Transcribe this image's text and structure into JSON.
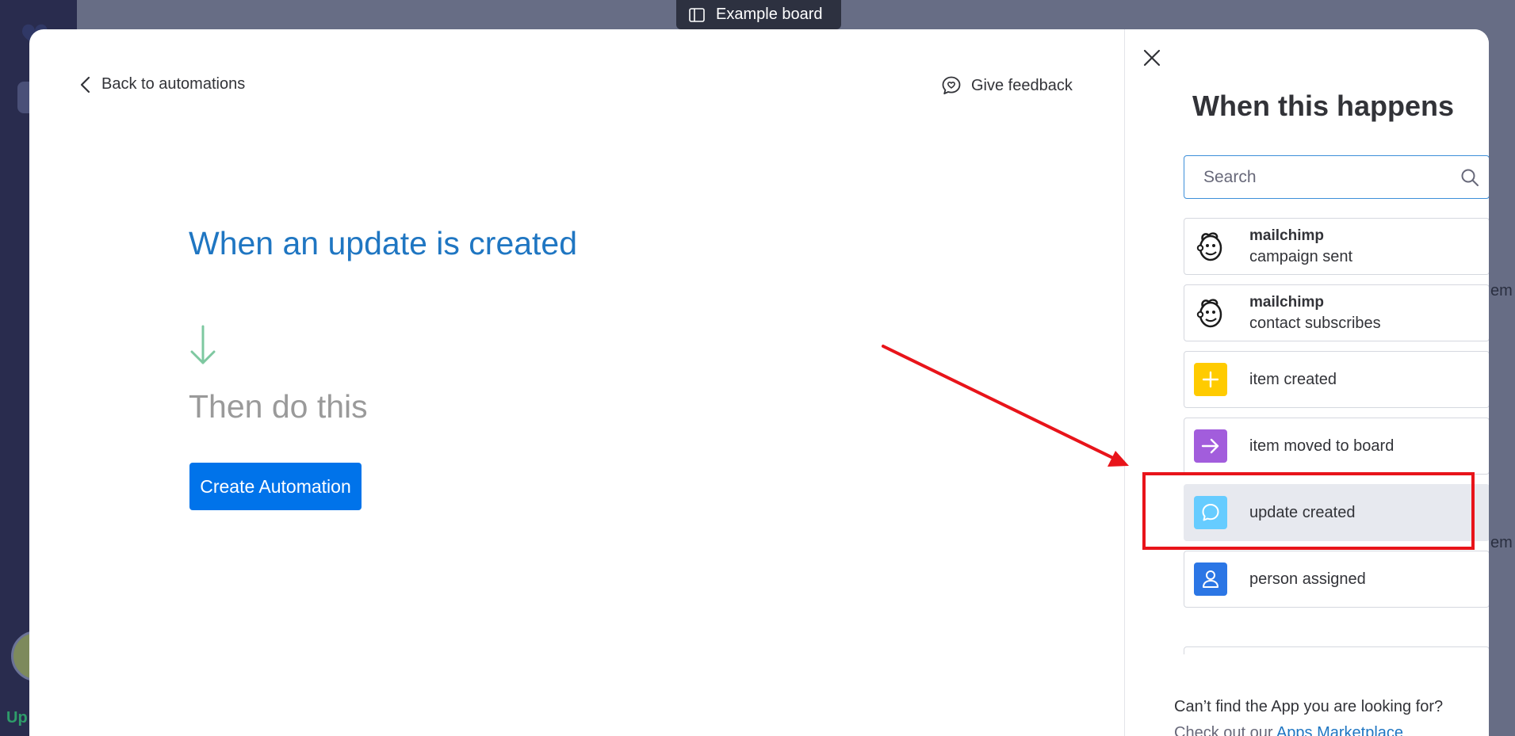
{
  "board_tooltip": {
    "label": "Example board"
  },
  "background": {
    "bottom_text": "Up",
    "right_text_1": "em",
    "right_text_2": "em"
  },
  "modal": {
    "back_label": "Back to automations",
    "feedback_label": "Give feedback",
    "headline": "When an update is created",
    "then_text": "Then do this",
    "create_button": "Create Automation"
  },
  "panel": {
    "title": "When this happens",
    "search_placeholder": "Search",
    "items": [
      {
        "title": "mailchimp",
        "subtitle": "campaign sent",
        "icon": "mailchimp-icon"
      },
      {
        "title": "mailchimp",
        "subtitle": "contact subscribes",
        "icon": "mailchimp-icon"
      },
      {
        "label": "item created",
        "icon": "plus-icon",
        "color": "#ffcb00"
      },
      {
        "label": "item moved to board",
        "icon": "arrow-right-icon",
        "color": "#a25ddc"
      },
      {
        "label": "update created",
        "icon": "chat-bubble-icon",
        "color": "#66ccff",
        "selected": true
      },
      {
        "label": "person assigned",
        "icon": "person-icon",
        "color": "#2b76e5"
      }
    ],
    "help_line1": "Can’t find the App you are looking for?",
    "help_line2_prefix": "Check out our ",
    "help_link": "Apps Marketplace"
  },
  "colors": {
    "accent": "#0073ea",
    "headline": "#1f76c2",
    "annotation": "#e8141a",
    "arrow_down": "#7ec8a0"
  }
}
